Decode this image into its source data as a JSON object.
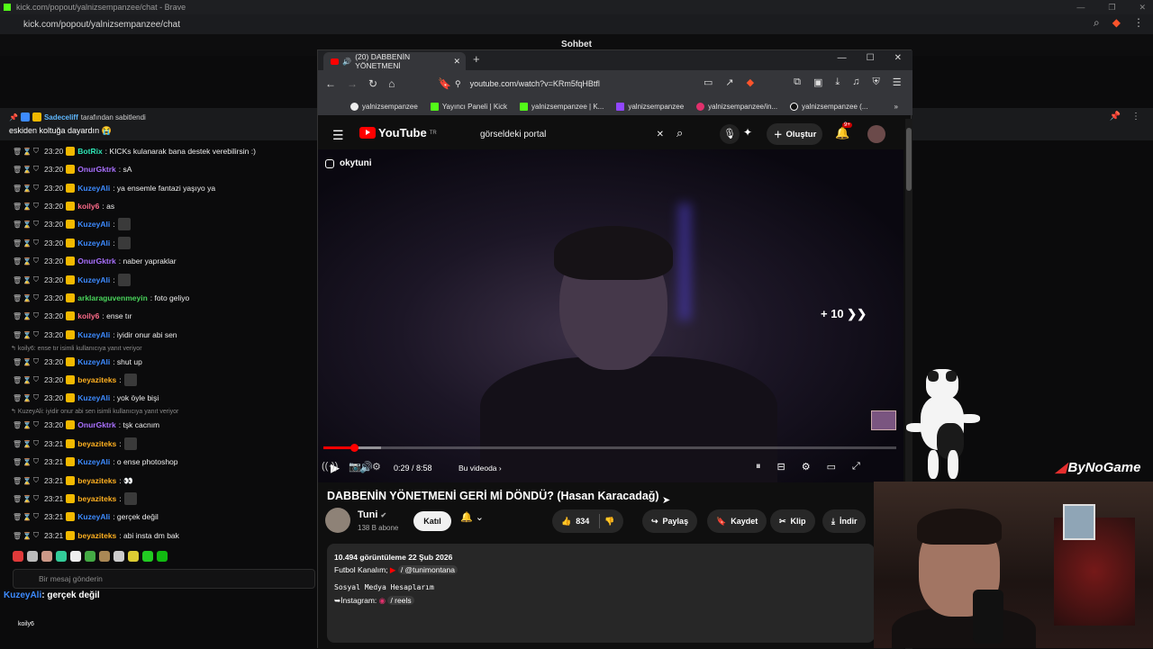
{
  "outer": {
    "title": "kick.com/popout/yalnizsempanzee/chat - Brave",
    "url": "kick.com/popout/yalnizsempanzee/chat",
    "chat_header": "Sohbet"
  },
  "pinned": {
    "by_user": "Sadeceliff",
    "by_text": "tarafından sabitlendi",
    "message": "eskiden koltuğa dayardın 😭"
  },
  "chat_messages": [
    {
      "time": "23:20",
      "user": "BotRix",
      "text": ": KICKs kulanarak bana destek verebilirsin :)",
      "color": "#2ee6b6"
    },
    {
      "time": "23:20",
      "user": "OnurGktrk",
      "text": ": sA",
      "color": "#a970ff"
    },
    {
      "time": "23:20",
      "user": "KuzeyAli",
      "text": ": ya ensemle fantazi yaşıyo ya",
      "color": "#3d8bff"
    },
    {
      "time": "23:20",
      "user": "koily6",
      "text": ": as",
      "color": "#ff6b8a"
    },
    {
      "time": "23:20",
      "user": "KuzeyAli",
      "text": ":",
      "color": "#3d8bff",
      "emote": true
    },
    {
      "time": "23:20",
      "user": "KuzeyAli",
      "text": ":",
      "color": "#3d8bff",
      "emote": true
    },
    {
      "time": "23:20",
      "user": "OnurGktrk",
      "text": ": naber yapraklar",
      "color": "#a970ff"
    },
    {
      "time": "23:20",
      "user": "KuzeyAli",
      "text": ":",
      "color": "#3d8bff",
      "emote": true
    },
    {
      "time": "23:20",
      "user": "arklaraguvenmeyin",
      "text": ": foto geliyo",
      "color": "#49d35b"
    },
    {
      "time": "23:20",
      "user": "koily6",
      "text": ": ense tır",
      "color": "#ff6b8a"
    },
    {
      "time": "23:20",
      "user": "KuzeyAli",
      "text": ": iyidir onur abi sen",
      "color": "#3d8bff"
    },
    {
      "time": "23:20",
      "user": "KuzeyAli",
      "text": ": shut up",
      "color": "#3d8bff"
    },
    {
      "time": "23:20",
      "user": "beyaziteks",
      "text": ":",
      "color": "#ffb020",
      "emote": true
    },
    {
      "time": "23:20",
      "user": "KuzeyAli",
      "text": ": yok öyle bişi",
      "color": "#3d8bff"
    },
    {
      "time": "23:20",
      "user": "OnurGktrk",
      "text": ": tşk cacnım",
      "color": "#a970ff"
    },
    {
      "time": "23:21",
      "user": "beyaziteks",
      "text": ":",
      "color": "#ffb020",
      "emote": true
    },
    {
      "time": "23:21",
      "user": "KuzeyAli",
      "text": ": o ense photoshop",
      "color": "#3d8bff"
    },
    {
      "time": "23:21",
      "user": "beyaziteks",
      "text": ": 👀",
      "color": "#ffb020"
    },
    {
      "time": "23:21",
      "user": "beyaziteks",
      "text": ":",
      "color": "#ffb020",
      "emote": true
    },
    {
      "time": "23:21",
      "user": "KuzeyAli",
      "text": ": gerçek değil",
      "color": "#3d8bff"
    },
    {
      "time": "23:21",
      "user": "beyaziteks",
      "text": ": abi insta dm bak",
      "color": "#ffb020"
    }
  ],
  "replies": [
    {
      "text": "koily6: ense tır isimli kullanıcıya yanıt veriyor"
    },
    {
      "text": "KuzeyAli: iyidir onur abi sen isimli kullanıcıya yanıt veriyor"
    }
  ],
  "send_placeholder": "Bir mesaj gönderin",
  "overlay_msg": {
    "user": "KuzeyAli",
    "text": ": gerçek değil"
  },
  "bottom_user": "koily6",
  "yt": {
    "tab_title": "(20) DABBENİN YÖNETMENİ",
    "url": "youtube.com/watch?v=KRm5fqHBtfl",
    "bookmarks": [
      "yalnizsempanzee",
      "Yayıncı Paneli | Kick",
      "yalnizsempanzee | K...",
      "yalnizsempanzee",
      "yalnizsempanzee/in...",
      "yalnizsempanzee (..."
    ],
    "logo": "YouTube",
    "logo_sup": "TR",
    "search_value": "görseldeki portal",
    "create_label": "Oluştur",
    "notif_badge": "9+",
    "watermark": "okytuni",
    "skip_label": "+ 10",
    "time_display": "0:29 / 8:58",
    "in_video": "Bu videoda",
    "progress": 0.054,
    "buffered": 0.1,
    "title": "DABBENİN YÖNETMENİ GERİ Mİ DÖNDÜ? (Hasan Karacadağ)",
    "channel": "Tuni",
    "subs": "138 B abone",
    "join": "Katıl",
    "likes": "834",
    "share": "Paylaş",
    "save": "Kaydet",
    "clip": "Klip",
    "download": "İndir",
    "views_date": "10.494 görüntüleme  22 Şub 2026",
    "desc1": "Futbol Kanalım;",
    "desc1_link": "/ @tunimontana",
    "desc2": "Sosyal Medya Hesaplarım",
    "desc3": "➥İnstagram:",
    "desc3_link": "/ reels"
  },
  "bynogame": "ByNoGame"
}
